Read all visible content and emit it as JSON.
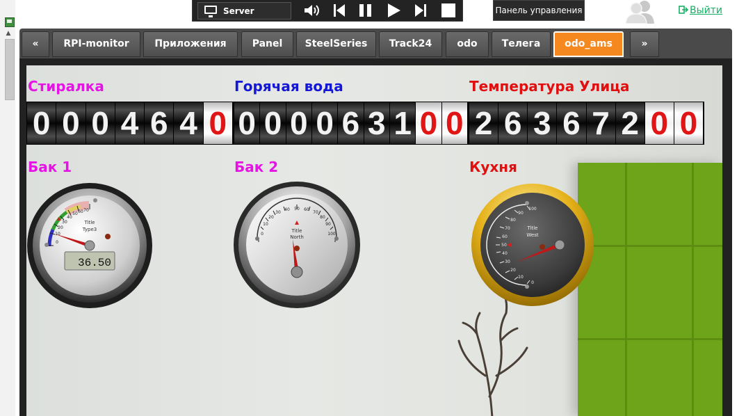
{
  "topbar": {
    "server_label": "Server",
    "panel_button": "Панель управления",
    "logout_label": "Выйти"
  },
  "tabs": [
    {
      "label": "«"
    },
    {
      "label": "RPI-monitor"
    },
    {
      "label": "Приложения"
    },
    {
      "label": "Panel"
    },
    {
      "label": "SteelSeries"
    },
    {
      "label": "Track24"
    },
    {
      "label": "odo"
    },
    {
      "label": "Телега"
    },
    {
      "label": "odo_ams",
      "active": true
    },
    {
      "label": "»"
    }
  ],
  "counters": [
    {
      "title": "Стиралка",
      "color": "#e514e5",
      "digits": "0004640",
      "red_digits": 1
    },
    {
      "title": "Горячая вода",
      "color": "#1418d6",
      "digits": "000063100",
      "red_digits": 2
    },
    {
      "title": "Температура Улица",
      "color": "#e01010",
      "digits": "263672 00",
      "red_digits": 2
    }
  ],
  "gauges": [
    {
      "title": "Бак 1",
      "color": "#e514e5",
      "gauge_title": "Title",
      "gauge_unit": "Type3",
      "lcd_value": "36.50",
      "scale": [
        "0",
        "10",
        "20",
        "30",
        "40",
        "50",
        "60",
        "70",
        "80",
        "90",
        "100"
      ]
    },
    {
      "title": "Бак 2",
      "color": "#e514e5",
      "gauge_title": "Title",
      "gauge_unit": "North",
      "scale": [
        "0",
        "10",
        "20",
        "30",
        "40",
        "50",
        "60",
        "70",
        "80",
        "90",
        "100"
      ]
    },
    {
      "title": "Кухня",
      "color": "#e01010",
      "gauge_title": "Title",
      "gauge_unit": "West",
      "scale": [
        "0",
        "10",
        "20",
        "30",
        "40",
        "50",
        "60",
        "70",
        "80",
        "90",
        "100"
      ]
    }
  ],
  "colors": {
    "accent_tab": "#f5881f",
    "logout": "#17b064",
    "green_wall": "#6da419"
  }
}
